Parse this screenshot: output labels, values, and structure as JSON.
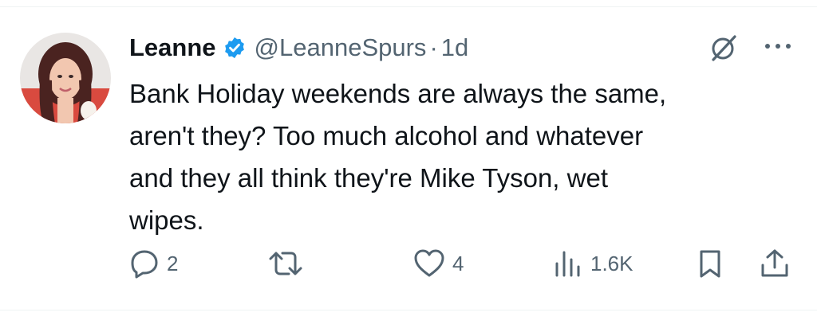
{
  "tweet": {
    "display_name": "Leanne",
    "handle": "@LeanneSpurs",
    "separator": "·",
    "timestamp": "1d",
    "text": "Bank Holiday weekends are always the same,\naren't they? Too much alcohol and whatever\nand they all think they're Mike Tyson, wet\nwipes.",
    "verified": true
  },
  "actions": {
    "reply_count": "2",
    "retweet_count": "",
    "like_count": "4",
    "views_count": "1.6K"
  },
  "icons": {
    "verified": "verified-badge-icon",
    "grok": "grok-icon",
    "more": "more-dots-icon",
    "reply": "reply-icon",
    "retweet": "retweet-icon",
    "like": "heart-icon",
    "views": "views-icon",
    "bookmark": "bookmark-icon",
    "share": "share-icon"
  },
  "colors": {
    "text": "#0f1419",
    "muted": "#536471",
    "verified_blue": "#1d9bf0",
    "divider": "#eff3f4"
  }
}
